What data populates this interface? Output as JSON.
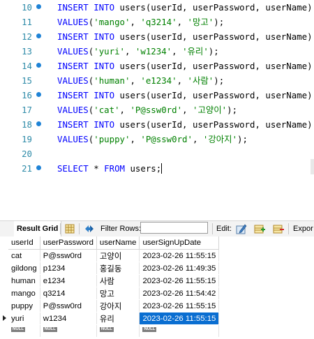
{
  "editor": {
    "lines": [
      {
        "num": "10",
        "marker": true,
        "tokens": [
          {
            "t": "kw",
            "v": "INSERT INTO"
          },
          {
            "t": "id",
            "v": " users(userId, userPassword, userName)"
          }
        ]
      },
      {
        "num": "11",
        "marker": false,
        "tokens": [
          {
            "t": "kw",
            "v": "VALUES"
          },
          {
            "t": "id",
            "v": "("
          },
          {
            "t": "str",
            "v": "'mango'"
          },
          {
            "t": "id",
            "v": ", "
          },
          {
            "t": "str",
            "v": "'q3214'"
          },
          {
            "t": "id",
            "v": ", "
          },
          {
            "t": "str",
            "v": "'망고'"
          },
          {
            "t": "id",
            "v": ");"
          }
        ]
      },
      {
        "num": "12",
        "marker": true,
        "tokens": [
          {
            "t": "kw",
            "v": "INSERT INTO"
          },
          {
            "t": "id",
            "v": " users(userId, userPassword, userName)"
          }
        ]
      },
      {
        "num": "13",
        "marker": false,
        "tokens": [
          {
            "t": "kw",
            "v": "VALUES"
          },
          {
            "t": "id",
            "v": "("
          },
          {
            "t": "str",
            "v": "'yuri'"
          },
          {
            "t": "id",
            "v": ", "
          },
          {
            "t": "str",
            "v": "'w1234'"
          },
          {
            "t": "id",
            "v": ", "
          },
          {
            "t": "str",
            "v": "'유리'"
          },
          {
            "t": "id",
            "v": ");"
          }
        ]
      },
      {
        "num": "14",
        "marker": true,
        "tokens": [
          {
            "t": "kw",
            "v": "INSERT INTO"
          },
          {
            "t": "id",
            "v": " users(userId, userPassword, userName)"
          }
        ]
      },
      {
        "num": "15",
        "marker": false,
        "tokens": [
          {
            "t": "kw",
            "v": "VALUES"
          },
          {
            "t": "id",
            "v": "("
          },
          {
            "t": "str",
            "v": "'human'"
          },
          {
            "t": "id",
            "v": ", "
          },
          {
            "t": "str",
            "v": "'e1234'"
          },
          {
            "t": "id",
            "v": ", "
          },
          {
            "t": "str",
            "v": "'사람'"
          },
          {
            "t": "id",
            "v": ");"
          }
        ]
      },
      {
        "num": "16",
        "marker": true,
        "tokens": [
          {
            "t": "kw",
            "v": "INSERT INTO"
          },
          {
            "t": "id",
            "v": " users(userId, userPassword, userName)"
          }
        ]
      },
      {
        "num": "17",
        "marker": false,
        "tokens": [
          {
            "t": "kw",
            "v": "VALUES"
          },
          {
            "t": "id",
            "v": "("
          },
          {
            "t": "str",
            "v": "'cat'"
          },
          {
            "t": "id",
            "v": ", "
          },
          {
            "t": "str",
            "v": "'P@ssw0rd'"
          },
          {
            "t": "id",
            "v": ", "
          },
          {
            "t": "str",
            "v": "'고양이'"
          },
          {
            "t": "id",
            "v": ");"
          }
        ]
      },
      {
        "num": "18",
        "marker": true,
        "tokens": [
          {
            "t": "kw",
            "v": "INSERT INTO"
          },
          {
            "t": "id",
            "v": " users(userId, userPassword, userName)"
          }
        ]
      },
      {
        "num": "19",
        "marker": false,
        "tokens": [
          {
            "t": "kw",
            "v": "VALUES"
          },
          {
            "t": "id",
            "v": "("
          },
          {
            "t": "str",
            "v": "'puppy'"
          },
          {
            "t": "id",
            "v": ", "
          },
          {
            "t": "str",
            "v": "'P@ssw0rd'"
          },
          {
            "t": "id",
            "v": ", "
          },
          {
            "t": "str",
            "v": "'강아지'"
          },
          {
            "t": "id",
            "v": ");"
          }
        ]
      },
      {
        "num": "20",
        "marker": false,
        "tokens": []
      },
      {
        "num": "21",
        "marker": true,
        "tokens": [
          {
            "t": "kw",
            "v": "SELECT"
          },
          {
            "t": "id",
            "v": " * "
          },
          {
            "t": "kw",
            "v": "FROM"
          },
          {
            "t": "id",
            "v": " users;"
          }
        ]
      }
    ]
  },
  "result_toolbar": {
    "tab_label": "Result Grid",
    "filter_label": "Filter Rows:",
    "filter_value": "",
    "edit_label": "Edit:",
    "export_label": "Expor",
    "icons": [
      "grid-view-icon",
      "refresh-icon",
      "edit-row-icon",
      "add-row-icon",
      "delete-row-icon"
    ]
  },
  "grid": {
    "columns": [
      "userId",
      "userPassword",
      "userName",
      "userSignUpDate"
    ],
    "rows": [
      [
        "cat",
        "P@ssw0rd",
        "고양이",
        "2023-02-26 11:55:15"
      ],
      [
        "gildong",
        "p1234",
        "홍길동",
        "2023-02-26 11:49:35"
      ],
      [
        "human",
        "e1234",
        "사람",
        "2023-02-26 11:55:15"
      ],
      [
        "mango",
        "q3214",
        "망고",
        "2023-02-26 11:54:42"
      ],
      [
        "puppy",
        "P@ssw0rd",
        "강아지",
        "2023-02-26 11:55:15"
      ],
      [
        "yuri",
        "w1234",
        "유리",
        "2023-02-26 11:55:15"
      ]
    ],
    "null_label": "NULL",
    "selected_row": 5,
    "selected_col": 3
  },
  "colors": {
    "keyword": "#0000ff",
    "string": "#008000",
    "line_number": "#2e8ba8",
    "selection": "#0a6ed1"
  }
}
